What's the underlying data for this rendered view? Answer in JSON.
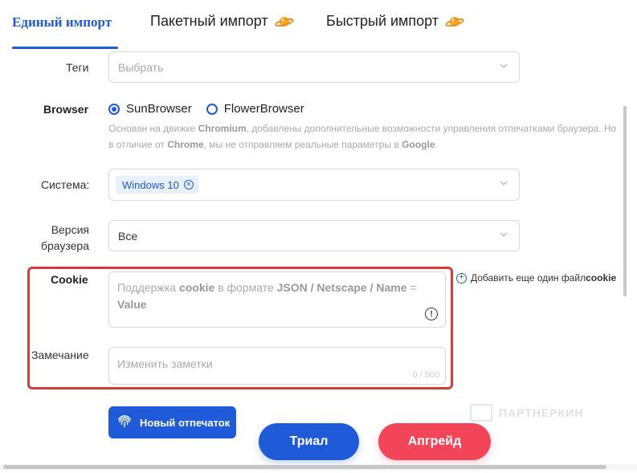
{
  "tabs": [
    {
      "label": "Единый импорт",
      "active": true
    },
    {
      "label": "Пакетный импорт",
      "icon": "planet-icon"
    },
    {
      "label": "Быстрый импорт",
      "icon": "planet-icon"
    }
  ],
  "form": {
    "tags": {
      "label": "Теги",
      "placeholder": "Выбрать"
    },
    "browser": {
      "label": "Browser",
      "options": [
        {
          "label": "SunBrowser",
          "selected": true
        },
        {
          "label": "FlowerBrowser",
          "selected": false
        }
      ],
      "description_parts": [
        "Основан на движке ",
        "Chromium",
        ", добавлены дополнительные возможности управления отпечатками браузера. Но",
        "в отличие от ",
        "Chrome",
        ", мы не отправляем реальные параметры в ",
        "Google",
        "."
      ]
    },
    "system": {
      "label": "Система:",
      "chip": "Windows 10"
    },
    "browser_version": {
      "label_line1": "Версия",
      "label_line2": "браузера",
      "value": "Все"
    },
    "cookie": {
      "label": "Cookie",
      "placeholder_parts": [
        "Поддержка ",
        "cookie",
        " в формате ",
        "JSON / Netscape / Name",
        " = ",
        "Value"
      ],
      "add_link_prefix": "Добавить еще один файл ",
      "add_link_bold": "cookie"
    },
    "note": {
      "label": "Замечание",
      "placeholder": "Изменить заметки",
      "counter": "0 / 500"
    }
  },
  "buttons": {
    "new_fingerprint": "Новый отпечаток",
    "trial": "Триал",
    "upgrade": "Апгрейд"
  },
  "watermark": "ПАРТНЕРКИН",
  "colors": {
    "accent": "#1f5ad8",
    "upgrade": "#f2455a",
    "highlight": "#d33d3d"
  }
}
